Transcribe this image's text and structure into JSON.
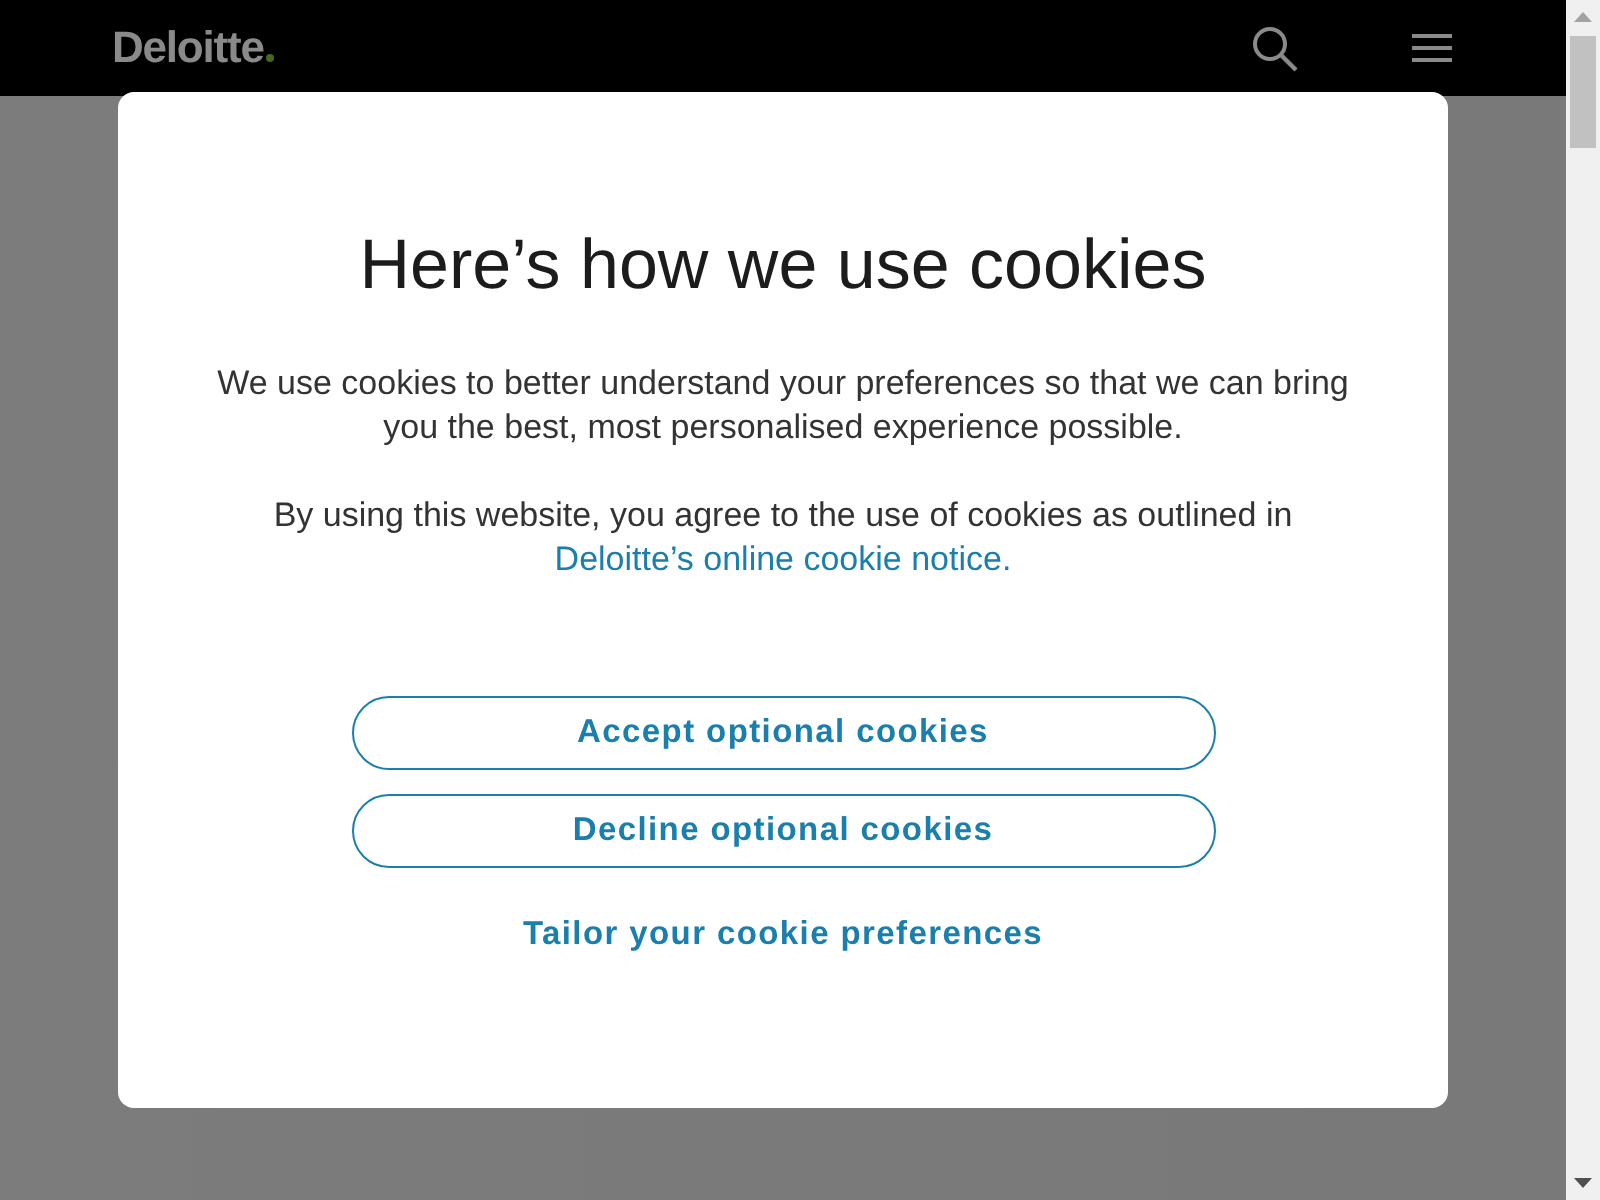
{
  "header": {
    "logo": "Deloitte"
  },
  "cookie_dialog": {
    "title": "Here’s how we use cookies",
    "paragraphs": [
      {
        "text": "We use cookies to better understand your preferences so that we can bring you the best, most personalised experience possible."
      },
      {
        "text": "By using this website, you agree to the use of cookies as outlined in",
        "link": "Deloitte’s online cookie notice."
      }
    ],
    "actions": [
      {
        "label": "Accept optional cookies",
        "kind": "outline"
      },
      {
        "label": "Decline optional cookies",
        "kind": "outline"
      },
      {
        "label": "Tailor your cookie preferences",
        "kind": "link"
      }
    ]
  }
}
